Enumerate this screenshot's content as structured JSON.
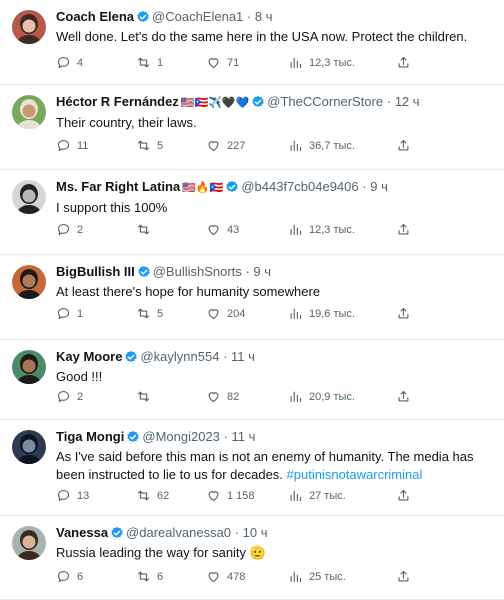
{
  "colors": {
    "link": "#1d9bf0",
    "verified": "#1d9bf0",
    "secondary_text": "#536471"
  },
  "icons": {
    "reply": "reply-icon",
    "retweet": "retweet-icon",
    "like": "heart-icon",
    "views": "views-icon",
    "share": "share-icon"
  },
  "tweets": [
    {
      "name": "Coach Elena",
      "flags": "",
      "handle": "@CoachElena1",
      "dot": "·",
      "time": "8 ч",
      "text": "Well done. Let's do the same here in the USA now. Protect the children.",
      "text_after": "",
      "hashtag": "",
      "replies": "4",
      "retweets": "1",
      "likes": "71",
      "views": "12,3 тыс."
    },
    {
      "name": "Héctor R Fernández",
      "flags": "🇺🇸🇵🇷✈️🖤💙",
      "handle": "@TheCCornerStore",
      "dot": "·",
      "time": "12 ч",
      "text": "Their country, their laws.",
      "text_after": "",
      "hashtag": "",
      "replies": "11",
      "retweets": "5",
      "likes": "227",
      "views": "36,7 тыс."
    },
    {
      "name": "Ms. Far Right Latina",
      "flags": "🇺🇸🔥🇵🇷",
      "handle": "@b443f7cb04e9406",
      "dot": "·",
      "time": "9 ч",
      "text": "I support this 100%",
      "text_after": "",
      "hashtag": "",
      "replies": "2",
      "retweets": "",
      "likes": "43",
      "views": "12,3 тыс."
    },
    {
      "name": "BigBullish III",
      "flags": "",
      "handle": "@BullishSnorts",
      "dot": "·",
      "time": "9 ч",
      "text": "At least there's hope for humanity somewhere",
      "text_after": "",
      "hashtag": "",
      "replies": "1",
      "retweets": "5",
      "likes": "204",
      "views": "19,6 тыс."
    },
    {
      "name": "Kay Moore",
      "flags": "",
      "handle": "@kaylynn554",
      "dot": "·",
      "time": "11 ч",
      "text": "Good !!!",
      "text_after": "",
      "hashtag": "",
      "replies": "2",
      "retweets": "",
      "likes": "82",
      "views": "20,9 тыс."
    },
    {
      "name": "Tiga Mongi",
      "flags": "",
      "handle": "@Mongi2023",
      "dot": "·",
      "time": "11 ч",
      "text": "As I've said before this man is not an enemy of humanity. The media has been instructed to lie to us for decades. ",
      "text_after": "",
      "hashtag": "#putinisnotawarcriminal",
      "replies": "13",
      "retweets": "62",
      "likes": "1 158",
      "views": "27 тыс."
    },
    {
      "name": "Vanessa",
      "flags": "",
      "handle": "@darealvanessa0",
      "dot": "·",
      "time": "10 ч",
      "text": "Russia leading the way for sanity ",
      "text_after": "🫡",
      "hashtag": "",
      "replies": "6",
      "retweets": "6",
      "likes": "478",
      "views": "25 тыс."
    }
  ]
}
